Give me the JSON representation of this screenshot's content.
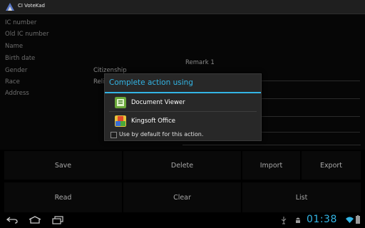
{
  "app": {
    "title": "CI VoteKad"
  },
  "form": {
    "fields": [
      "IC number",
      "Old IC number",
      "Name",
      "Birth date",
      "Gender",
      "Race",
      "Address"
    ],
    "citizenship_label": "Citizenship",
    "religion_label": "Relig",
    "remark_label": "Remark 1"
  },
  "buttons": {
    "save": "Save",
    "delete": "Delete",
    "import": "Import",
    "export": "Export",
    "read": "Read",
    "clear": "Clear",
    "list": "List"
  },
  "dialog": {
    "title": "Complete action using",
    "options": [
      {
        "label": "Document Viewer",
        "icon": "document-viewer-icon"
      },
      {
        "label": "Kingsoft Office",
        "icon": "kingsoft-office-icon"
      }
    ],
    "default_label": "Use by default for this action."
  },
  "status": {
    "time": "01:38"
  },
  "colors": {
    "accent": "#33b5e5",
    "background": "#000000",
    "dialog": "#282828"
  }
}
